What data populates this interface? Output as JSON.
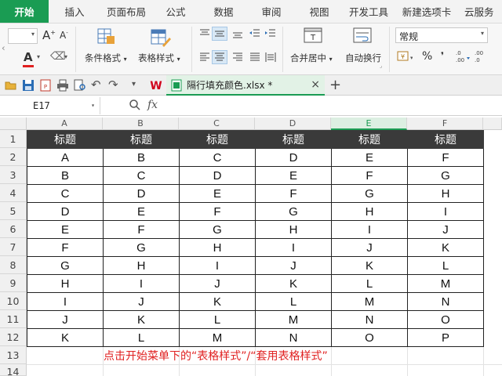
{
  "menu": {
    "tabs": [
      {
        "label": "开始",
        "active": true
      },
      {
        "label": "插入"
      },
      {
        "label": "页面布局"
      },
      {
        "label": "公式"
      },
      {
        "label": "数据"
      },
      {
        "label": "审阅"
      },
      {
        "label": "视图"
      },
      {
        "label": "开发工具"
      },
      {
        "label": "新建选项卡"
      },
      {
        "label": "云服务"
      }
    ]
  },
  "ribbon": {
    "conditional_format": "条件格式",
    "table_style": "表格样式",
    "merge_center": "合并居中",
    "wrap_text": "自动换行",
    "number_format": "常规",
    "percent": "%",
    "comma": "❜",
    "font_color_letter": "A"
  },
  "document": {
    "tab_name": "隔行填充颜色.xlsx *",
    "close": "×",
    "new_tab": "+"
  },
  "formula_bar": {
    "cell_ref": "E17",
    "fx": "fx"
  },
  "sheet": {
    "columns": [
      "A",
      "B",
      "C",
      "D",
      "E",
      "F"
    ],
    "rows": [
      "1",
      "2",
      "3",
      "4",
      "5",
      "6",
      "7",
      "8",
      "9",
      "10",
      "11",
      "12",
      "13",
      "14"
    ],
    "header_row": [
      "标题",
      "标题",
      "标题",
      "标题",
      "标题",
      "标题"
    ],
    "data": [
      [
        "A",
        "B",
        "C",
        "D",
        "E",
        "F"
      ],
      [
        "B",
        "C",
        "D",
        "E",
        "F",
        "G"
      ],
      [
        "C",
        "D",
        "E",
        "F",
        "G",
        "H"
      ],
      [
        "D",
        "E",
        "F",
        "G",
        "H",
        "I"
      ],
      [
        "E",
        "F",
        "G",
        "H",
        "I",
        "J"
      ],
      [
        "F",
        "G",
        "H",
        "I",
        "J",
        "K"
      ],
      [
        "G",
        "H",
        "I",
        "J",
        "K",
        "L"
      ],
      [
        "H",
        "I",
        "J",
        "K",
        "L",
        "M"
      ],
      [
        "I",
        "J",
        "K",
        "L",
        "M",
        "N"
      ],
      [
        "J",
        "K",
        "L",
        "M",
        "N",
        "O"
      ],
      [
        "K",
        "L",
        "M",
        "N",
        "O",
        "P"
      ]
    ],
    "selected_column": "E"
  },
  "note": "点击开始菜单下的“表格样式”/“套用表格样式”",
  "colors": {
    "accent": "#1a9c53",
    "header_fill": "#3a3a3a",
    "note_red": "#e02020"
  }
}
